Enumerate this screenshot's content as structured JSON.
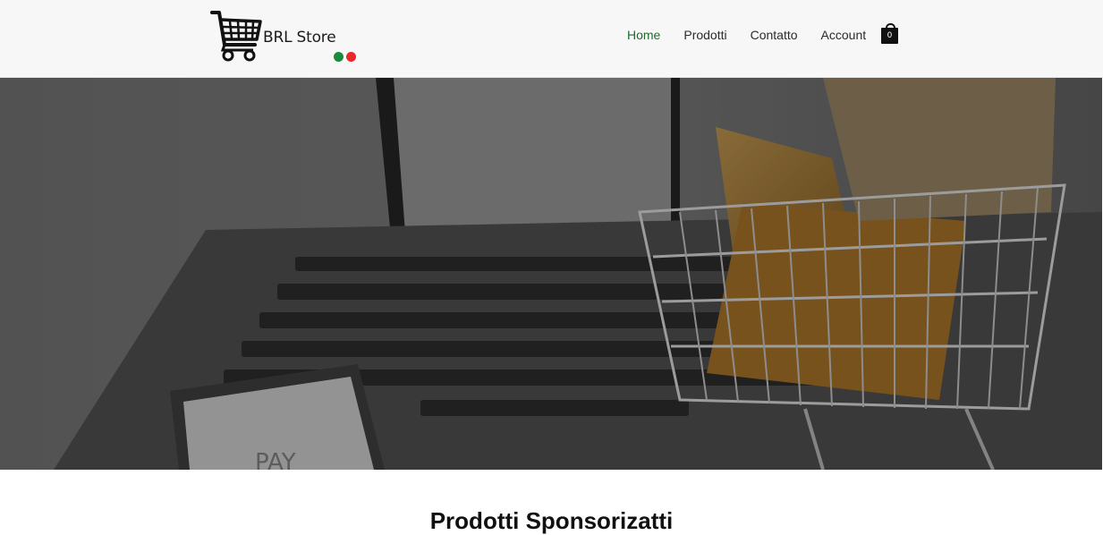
{
  "brand": {
    "name": "BRL Store",
    "flag_colors": [
      "#1c8a3c",
      "#e52a2a"
    ]
  },
  "nav": {
    "items": [
      {
        "label": "Home",
        "active": true
      },
      {
        "label": "Prodotti",
        "active": false
      },
      {
        "label": "Contatto",
        "active": false
      },
      {
        "label": "Account",
        "active": false
      }
    ],
    "active_color": "#1e6b2a"
  },
  "cart": {
    "icon": "shopping-bag-icon",
    "count": "0"
  },
  "hero": {
    "image": "laptop-and-shopping-cart-photo",
    "keyboard_text": "PAY"
  },
  "section": {
    "title": "Prodotti Sponsorizatti"
  }
}
